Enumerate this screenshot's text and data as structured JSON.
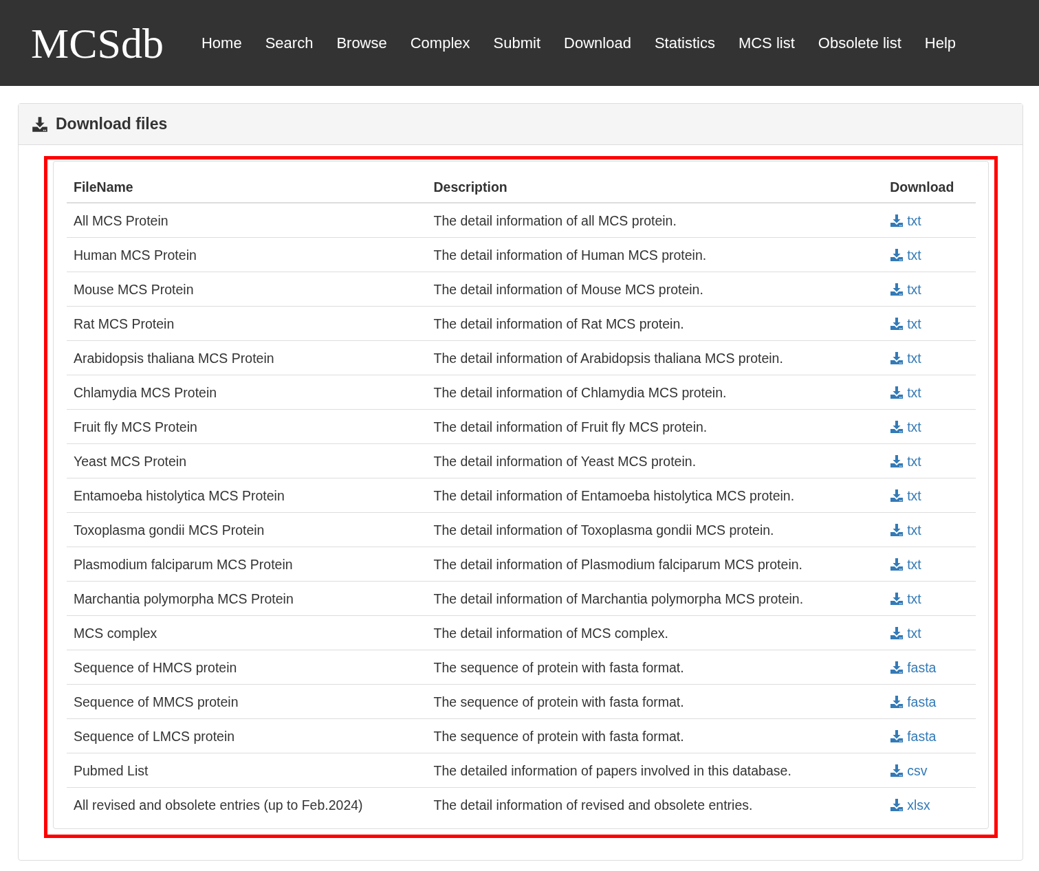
{
  "navbar": {
    "brand": "MCSdb",
    "items": [
      "Home",
      "Search",
      "Browse",
      "Complex",
      "Submit",
      "Download",
      "Statistics",
      "MCS list",
      "Obsolete list",
      "Help"
    ]
  },
  "panel": {
    "title": "Download files"
  },
  "table": {
    "columns": [
      "FileName",
      "Description",
      "Download"
    ],
    "rows": [
      {
        "name": "All MCS Protein",
        "description": "The detail information of all MCS protein.",
        "format": "txt"
      },
      {
        "name": "Human MCS Protein",
        "description": "The detail information of Human MCS protein.",
        "format": "txt"
      },
      {
        "name": "Mouse MCS Protein",
        "description": "The detail information of Mouse MCS protein.",
        "format": "txt"
      },
      {
        "name": "Rat MCS Protein",
        "description": "The detail information of Rat MCS protein.",
        "format": "txt"
      },
      {
        "name": "Arabidopsis thaliana MCS Protein",
        "description": "The detail information of Arabidopsis thaliana MCS protein.",
        "format": "txt"
      },
      {
        "name": "Chlamydia MCS Protein",
        "description": "The detail information of Chlamydia MCS protein.",
        "format": "txt"
      },
      {
        "name": "Fruit fly MCS Protein",
        "description": "The detail information of Fruit fly MCS protein.",
        "format": "txt"
      },
      {
        "name": "Yeast MCS Protein",
        "description": "The detail information of Yeast MCS protein.",
        "format": "txt"
      },
      {
        "name": "Entamoeba histolytica MCS Protein",
        "description": "The detail information of Entamoeba histolytica MCS protein.",
        "format": "txt"
      },
      {
        "name": "Toxoplasma gondii MCS Protein",
        "description": "The detail information of Toxoplasma gondii MCS protein.",
        "format": "txt"
      },
      {
        "name": "Plasmodium falciparum MCS Protein",
        "description": "The detail information of Plasmodium falciparum MCS protein.",
        "format": "txt"
      },
      {
        "name": "Marchantia polymorpha MCS Protein",
        "description": "The detail information of Marchantia polymorpha MCS protein.",
        "format": "txt"
      },
      {
        "name": "MCS complex",
        "description": "The detail information of MCS complex.",
        "format": "txt"
      },
      {
        "name": "Sequence of HMCS protein",
        "description": "The sequence of protein with fasta format.",
        "format": "fasta"
      },
      {
        "name": "Sequence of MMCS protein",
        "description": "The sequence of protein with fasta format.",
        "format": "fasta"
      },
      {
        "name": "Sequence of LMCS protein",
        "description": "The sequence of protein with fasta format.",
        "format": "fasta"
      },
      {
        "name": "Pubmed List",
        "description": "The detailed information of papers involved in this database.",
        "format": "csv"
      },
      {
        "name": "All revised and obsolete entries (up to Feb.2024)",
        "description": "The detail information of revised and obsolete entries.",
        "format": "xlsx"
      }
    ]
  }
}
